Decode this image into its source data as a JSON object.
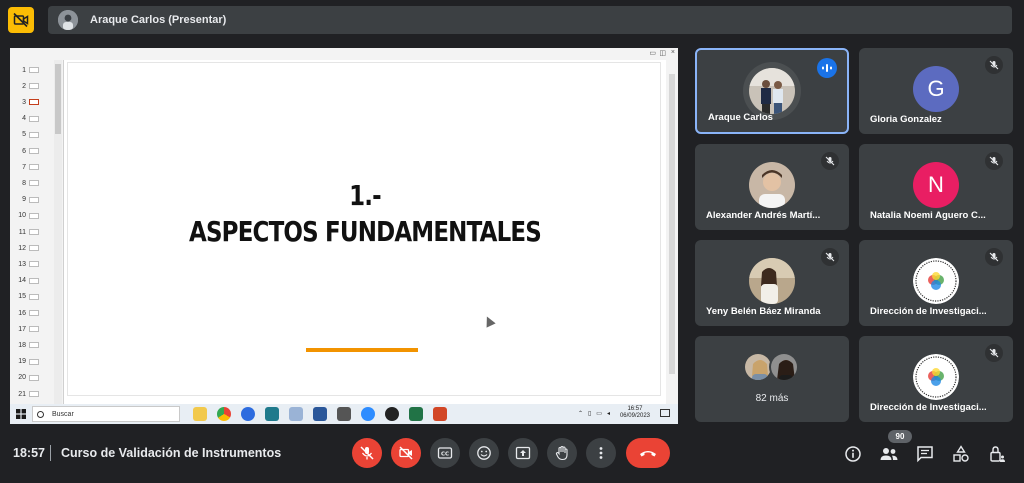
{
  "top_bar": {
    "presenter_label": "Araque Carlos (Presentar)",
    "camera_badge_icon": "camera-off-icon"
  },
  "shared_screen": {
    "slide": {
      "title_line1": "1.-",
      "title_line2": "ASPECTOS FUNDAMENTALES",
      "accent_color": "#f29300"
    },
    "slide_numbers": [
      "1",
      "2",
      "3",
      "4",
      "5",
      "6",
      "7",
      "8",
      "9",
      "10",
      "11",
      "12",
      "13",
      "14",
      "15",
      "16",
      "17",
      "18",
      "19",
      "20",
      "21"
    ],
    "active_slide": "3",
    "taskbar": {
      "search_placeholder": "Buscar",
      "clock_time": "16:57",
      "clock_date": "06/09/2023"
    }
  },
  "participants": [
    {
      "name": "Araque Carlos",
      "kind": "photo",
      "speaking": true
    },
    {
      "name": "Gloria Gonzalez",
      "kind": "initial",
      "initial": "G",
      "color": "#5c6bc0",
      "muted": true
    },
    {
      "name": "Alexander Andrés Martí...",
      "kind": "photo",
      "muted": true
    },
    {
      "name": "Natalia Noemi Aguero C...",
      "kind": "initial",
      "initial": "N",
      "color": "#e91e63",
      "muted": true
    },
    {
      "name": "Yeny Belén Báez Miranda",
      "kind": "photo",
      "muted": true
    },
    {
      "name": "Dirección de Investigaci...",
      "kind": "logo",
      "muted": true
    },
    {
      "name": "82 más",
      "kind": "more"
    },
    {
      "name": "Dirección de Investigaci...",
      "kind": "logo",
      "muted": true
    }
  ],
  "bottom_bar": {
    "time": "18:57",
    "meeting_title": "Curso de Validación de Instrumentos",
    "participant_count": "90",
    "colors": {
      "danger": "#ea4335",
      "control_bg": "#3c4043",
      "accent_blue": "#1a73e8"
    }
  }
}
